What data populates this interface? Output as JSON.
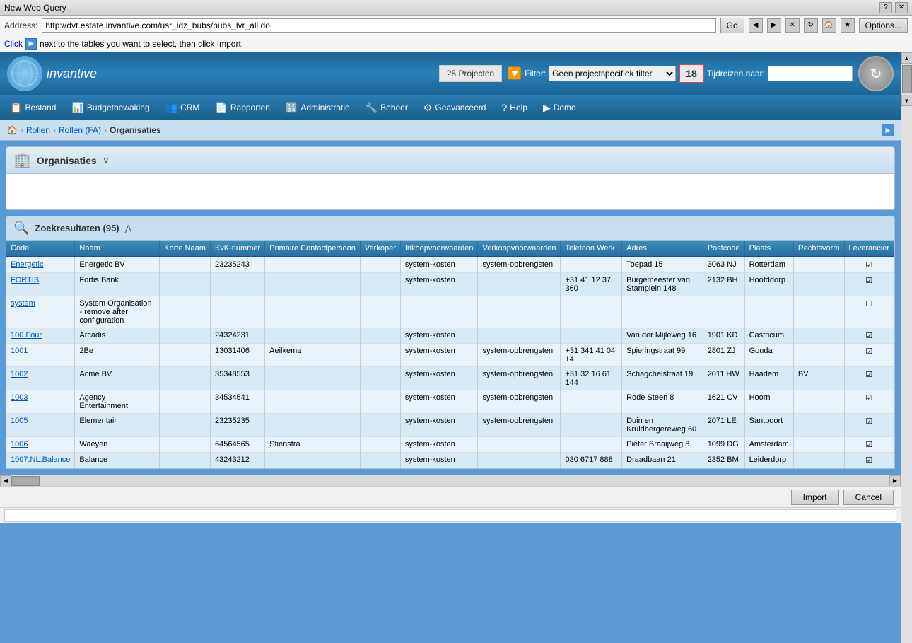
{
  "titleBar": {
    "title": "New Web Query",
    "helpBtn": "?",
    "closeBtn": "✕"
  },
  "addressBar": {
    "label": "Address:",
    "url": "http://dvt.estate.invantive.com/usr_idz_bubs/bubs_lvr_all.do",
    "goBtn": "Go",
    "optionsBtn": "Options..."
  },
  "clickBar": {
    "clickText": "Click",
    "arrowIcon": "▶",
    "restText": "next to the tables you want to select, then click Import."
  },
  "header": {
    "logoText": "invantive",
    "projectsBadge": "25 Projecten",
    "filterLabel": "Filter:",
    "filterValue": "Geen projectspecifiek filter",
    "filterOptions": [
      "Geen projectspecifiek filter"
    ],
    "dateBadge": "18",
    "tijdreizenLabel": "Tijdreizen naar:",
    "tijdreizenValue": ""
  },
  "navMenu": {
    "items": [
      {
        "label": "Bestand",
        "icon": "📋"
      },
      {
        "label": "Budgetbewaking",
        "icon": "📊"
      },
      {
        "label": "CRM",
        "icon": "👥"
      },
      {
        "label": "Rapporten",
        "icon": "📄"
      },
      {
        "label": "Administratie",
        "icon": "🔢"
      },
      {
        "label": "Beheer",
        "icon": "🔧"
      },
      {
        "label": "Geavanceerd",
        "icon": "⚙"
      },
      {
        "label": "Help",
        "icon": "?"
      },
      {
        "label": "Demo",
        "icon": "▶"
      }
    ]
  },
  "breadcrumb": {
    "home": "🏠",
    "items": [
      "Rollen",
      "Rollen (FA)",
      "Organisaties"
    ]
  },
  "panel": {
    "title": "Organisaties",
    "icon": "🏢",
    "toggleIcon": "∨"
  },
  "searchResults": {
    "title": "Zoekresultaten (95)",
    "collapseIcon": "⋀"
  },
  "tableHeaders": [
    "Code",
    "Naam",
    "Korte Naam",
    "KvK-nummer",
    "Primaire Contactpersoon",
    "Verkoper",
    "Inkoopvoorwaarden",
    "Verkoopvoorwaarden",
    "Telefoon Werk",
    "Adres",
    "Postcode",
    "Plaats",
    "Rechtsvorm",
    "Leverancier"
  ],
  "tableRows": [
    {
      "code": "Energetic",
      "naam": "Energetic BV",
      "korteNaam": "",
      "kvk": "23235243",
      "primaire": "",
      "verkoper": "",
      "inkoop": "system-kosten",
      "verkoop": "system-opbrengsten",
      "telefoon": "",
      "adres": "Toepad 15",
      "postcode": "3063 NJ",
      "plaats": "Rotterdam",
      "rechtsvorm": "",
      "leverancier": true,
      "isLink": true
    },
    {
      "code": "FORTIS",
      "naam": "Fortis Bank",
      "korteNaam": "",
      "kvk": "",
      "primaire": "",
      "verkoper": "",
      "inkoop": "system-kosten",
      "verkoop": "",
      "telefoon": "+31 41 12 37 360",
      "adres": "Burgemeester van Stamplein 148",
      "postcode": "2132 BH",
      "plaats": "Hoofddorp",
      "rechtsvorm": "",
      "leverancier": true,
      "isLink": true
    },
    {
      "code": "system",
      "naam": "System Organisation - remove after configuration",
      "korteNaam": "",
      "kvk": "",
      "primaire": "",
      "verkoper": "",
      "inkoop": "",
      "verkoop": "",
      "telefoon": "",
      "adres": "",
      "postcode": "",
      "plaats": "",
      "rechtsvorm": "",
      "leverancier": false,
      "isLink": true
    },
    {
      "code": "100.Four",
      "naam": "Arcadis",
      "korteNaam": "",
      "kvk": "24324231",
      "primaire": "",
      "verkoper": "",
      "inkoop": "system-kosten",
      "verkoop": "",
      "telefoon": "",
      "adres": "Van der Mijleweg 16",
      "postcode": "1901 KD",
      "plaats": "Castricum",
      "rechtsvorm": "",
      "leverancier": true,
      "isLink": true
    },
    {
      "code": "1001",
      "naam": "2Be",
      "korteNaam": "",
      "kvk": "13031406",
      "primaire": "Aeilkema",
      "verkoper": "",
      "inkoop": "system-kosten",
      "verkoop": "system-opbrengsten",
      "telefoon": "+31 341 41 04 14",
      "adres": "Spieringstraat 99",
      "postcode": "2801 ZJ",
      "plaats": "Gouda",
      "rechtsvorm": "",
      "leverancier": true,
      "isLink": true
    },
    {
      "code": "1002",
      "naam": "Acme BV",
      "korteNaam": "",
      "kvk": "35348553",
      "primaire": "",
      "verkoper": "",
      "inkoop": "system-kosten",
      "verkoop": "system-opbrengsten",
      "telefoon": "+31 32 16 61 144",
      "adres": "Schagchelstraat 19",
      "postcode": "2011 HW",
      "plaats": "Haarlem",
      "rechtsvorm": "BV",
      "leverancier": true,
      "isLink": true
    },
    {
      "code": "1003",
      "naam": "Agency Entertainment",
      "korteNaam": "",
      "kvk": "34534541",
      "primaire": "",
      "verkoper": "",
      "inkoop": "system-kosten",
      "verkoop": "system-opbrengsten",
      "telefoon": "",
      "adres": "Rode Steen 8",
      "postcode": "1621 CV",
      "plaats": "Hoorn",
      "rechtsvorm": "",
      "leverancier": true,
      "isLink": true
    },
    {
      "code": "1005",
      "naam": "Elementair",
      "korteNaam": "",
      "kvk": "23235235",
      "primaire": "",
      "verkoper": "",
      "inkoop": "system-kosten",
      "verkoop": "system-opbrengsten",
      "telefoon": "",
      "adres": "Duin en Kruidbergereweg 60",
      "postcode": "2071 LE",
      "plaats": "Santpoort",
      "rechtsvorm": "",
      "leverancier": true,
      "isLink": true
    },
    {
      "code": "1006",
      "naam": "Waeyen",
      "korteNaam": "",
      "kvk": "64564565",
      "primaire": "Stienstra",
      "verkoper": "",
      "inkoop": "system-kosten",
      "verkoop": "",
      "telefoon": "",
      "adres": "Pieter Braaijweg 8",
      "postcode": "1099 DG",
      "plaats": "Amsterdam",
      "rechtsvorm": "",
      "leverancier": true,
      "isLink": true
    },
    {
      "code": "1007.NL.Balance",
      "naam": "Balance",
      "korteNaam": "",
      "kvk": "43243212",
      "primaire": "",
      "verkoper": "",
      "inkoop": "system-kosten",
      "verkoop": "",
      "telefoon": "030 6717 888",
      "adres": "Draadbaan 21",
      "postcode": "2352 BM",
      "plaats": "Leiderdorp",
      "rechtsvorm": "",
      "leverancier": true,
      "isLink": true
    }
  ],
  "bottomBar": {
    "importBtn": "Import",
    "cancelBtn": "Cancel"
  }
}
